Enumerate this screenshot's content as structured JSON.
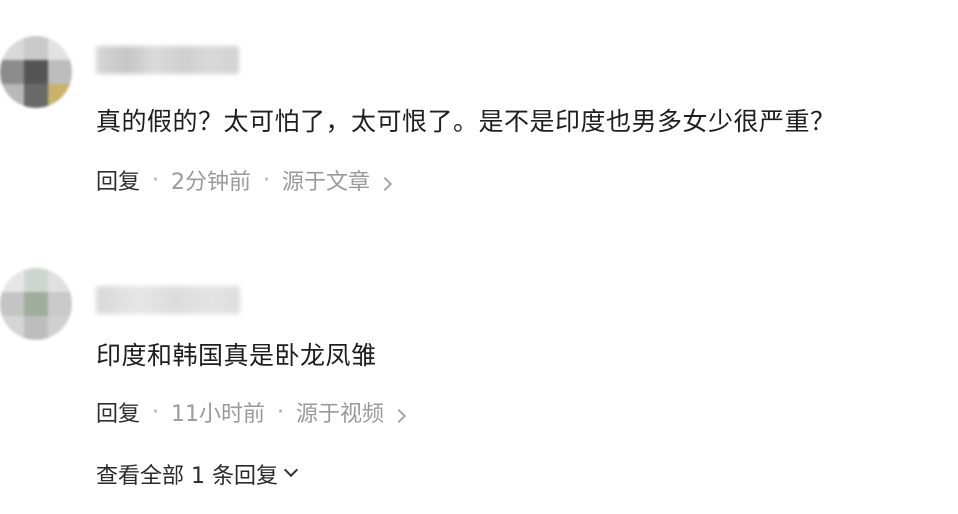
{
  "comments": [
    {
      "text": "真的假的？太可怕了，太可恨了。是不是印度也男多女少很严重？",
      "reply_label": "回复",
      "time": "2分钟前",
      "source": "源于文章"
    },
    {
      "text": "印度和韩国真是卧龙凤雏",
      "reply_label": "回复",
      "time": "11小时前",
      "source": "源于视频",
      "view_all_replies": "查看全部 1 条回复"
    }
  ],
  "icons": {
    "avatar": "avatar",
    "source_arrow": "chevron-right-icon",
    "expand_arrow": "chevron-down-icon"
  }
}
